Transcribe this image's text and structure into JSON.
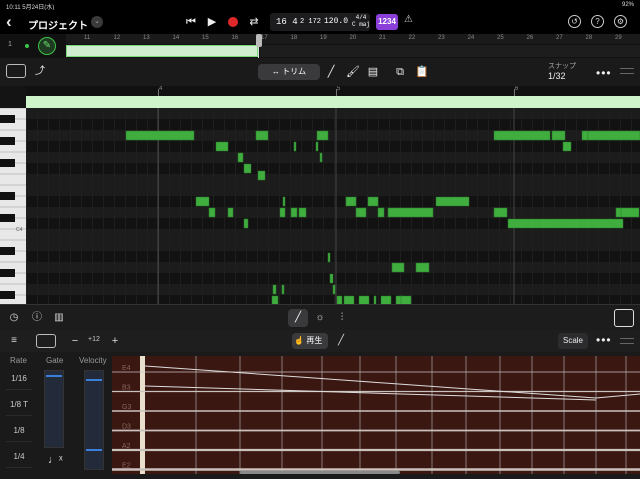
{
  "status": {
    "time_date": "10:11  5月24日(水)",
    "battery": "92%"
  },
  "header": {
    "project_title": "プロジェクト",
    "lcd": {
      "bar_beat": "16 4",
      "sub": "2 172",
      "tempo": "120.0",
      "sig_top": "4/4",
      "sig_key": "C maj"
    },
    "count_in": "1234"
  },
  "track": {
    "number": "1",
    "ruler": [
      "11",
      "12",
      "13",
      "14",
      "15",
      "16",
      "17",
      "18",
      "19",
      "20",
      "21",
      "22",
      "23",
      "24",
      "25",
      "26",
      "27",
      "28",
      "29",
      "30"
    ]
  },
  "editor_toolbar": {
    "trim_label": "トリム",
    "snap_label": "スナップ",
    "snap_value": "1/32"
  },
  "piano_roll": {
    "ruler": [
      "4",
      "5",
      "6"
    ],
    "c4_label": "C4"
  },
  "panel": {
    "octave_value": "+12",
    "play_label": "再生",
    "scale_label": "Scale"
  },
  "arp": {
    "rate_header": "Rate",
    "gate_header": "Gate",
    "velocity_header": "Velocity",
    "rates": [
      "1/16",
      "1/8 T",
      "1/8",
      "1/4"
    ]
  },
  "strings": [
    "E4",
    "B3",
    "G3",
    "D3",
    "A2",
    "E2"
  ],
  "notes": [
    [
      100,
      22,
      68
    ],
    [
      190,
      33,
      12
    ],
    [
      212,
      44,
      5
    ],
    [
      218,
      55,
      7
    ],
    [
      230,
      22,
      12
    ],
    [
      232,
      62,
      7
    ],
    [
      268,
      33,
      2
    ],
    [
      291,
      22,
      11
    ],
    [
      290,
      33,
      2
    ],
    [
      294,
      44,
      2
    ],
    [
      170,
      88,
      13
    ],
    [
      183,
      99,
      6
    ],
    [
      202,
      99,
      5
    ],
    [
      218,
      110,
      4
    ],
    [
      254,
      99,
      5
    ],
    [
      257,
      88,
      2
    ],
    [
      265,
      99,
      6
    ],
    [
      273,
      99,
      7
    ],
    [
      320,
      88,
      10
    ],
    [
      330,
      99,
      10
    ],
    [
      342,
      88,
      10
    ],
    [
      352,
      99,
      6
    ],
    [
      362,
      99,
      45
    ],
    [
      410,
      88,
      33
    ],
    [
      468,
      22,
      56
    ],
    [
      526,
      22,
      13
    ],
    [
      537,
      33,
      8
    ],
    [
      556,
      22,
      6
    ],
    [
      562,
      22,
      52
    ],
    [
      590,
      99,
      6
    ],
    [
      468,
      99,
      13
    ],
    [
      482,
      110,
      115
    ],
    [
      595,
      99,
      18
    ],
    [
      366,
      154,
      12
    ],
    [
      390,
      154,
      13
    ],
    [
      304,
      165,
      3
    ],
    [
      307,
      176,
      2
    ],
    [
      311,
      187,
      5
    ],
    [
      318,
      187,
      10
    ],
    [
      333,
      187,
      10
    ],
    [
      348,
      187,
      2
    ],
    [
      355,
      187,
      10
    ],
    [
      370,
      187,
      7
    ],
    [
      375,
      187,
      10
    ],
    [
      378,
      198,
      10
    ],
    [
      246,
      187,
      6
    ],
    [
      248,
      198,
      10
    ],
    [
      247,
      176,
      3
    ],
    [
      256,
      176,
      2
    ],
    [
      302,
      144,
      2
    ]
  ],
  "colors": {
    "note": "#3fae3f",
    "region": "#cdf4cb",
    "accent_purple": "#8b3fd9",
    "record": "#e0282b"
  }
}
